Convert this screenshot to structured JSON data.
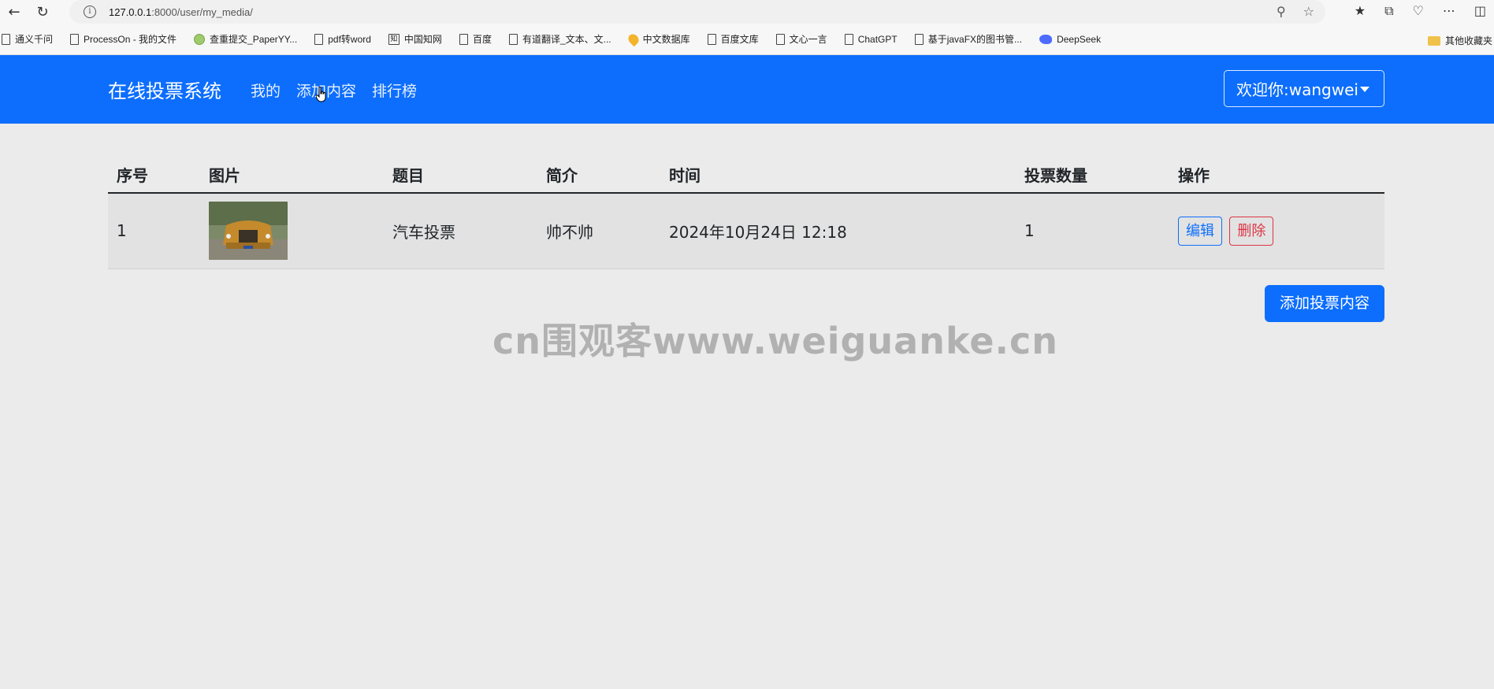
{
  "browser": {
    "url_host": "127.0.0.1",
    "url_path": ":8000/user/my_media/",
    "bookmarks": [
      {
        "label": "通义千问",
        "icon": "doc"
      },
      {
        "label": "ProcessOn - 我的文件",
        "icon": "doc"
      },
      {
        "label": "查重提交_PaperYY...",
        "icon": "round"
      },
      {
        "label": "pdf转word",
        "icon": "doc"
      },
      {
        "label": "中国知网",
        "icon": "zhi"
      },
      {
        "label": "百度",
        "icon": "doc"
      },
      {
        "label": "有道翻译_文本、文...",
        "icon": "doc"
      },
      {
        "label": "中文数据库",
        "icon": "pin"
      },
      {
        "label": "百度文库",
        "icon": "doc"
      },
      {
        "label": "文心一言",
        "icon": "doc"
      },
      {
        "label": "ChatGPT",
        "icon": "doc"
      },
      {
        "label": "基于javaFX的图书管...",
        "icon": "doc"
      },
      {
        "label": "DeepSeek",
        "icon": "bird"
      }
    ],
    "other_bookmarks": "其他收藏夹"
  },
  "navbar": {
    "brand": "在线投票系统",
    "links": [
      "我的",
      "添加内容",
      "排行榜"
    ],
    "user_menu": "欢迎你:wangwei"
  },
  "table": {
    "headers": [
      "序号",
      "图片",
      "题目",
      "简介",
      "时间",
      "投票数量",
      "操作"
    ],
    "rows": [
      {
        "index": "1",
        "title": "汽车投票",
        "intro": "帅不帅",
        "time": "2024年10月24日 12:18",
        "votes": "1",
        "edit": "编辑",
        "delete": "删除"
      }
    ]
  },
  "add_button": "添加投票内容",
  "watermark": "cn围观客www.weiguanke.cn",
  "colors": {
    "primary": "#0d6efd",
    "danger": "#dc3545",
    "background": "#ebebeb"
  }
}
